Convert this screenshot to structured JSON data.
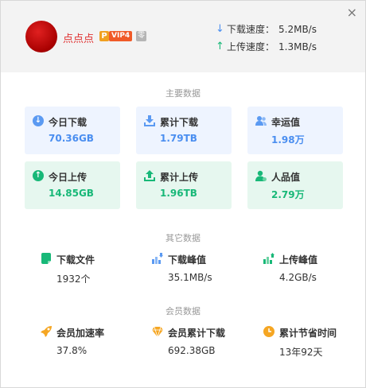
{
  "header": {
    "username": "点点点",
    "badge_p": "P",
    "badge_vip": "VIP4",
    "badge_level": "零",
    "close_icon": "×",
    "download_speed_label": "下载速度：",
    "download_speed_value": "5.2MB/s",
    "upload_speed_label": "上传速度：",
    "upload_speed_value": "1.3MB/s"
  },
  "main_section": {
    "title": "主要数据",
    "cards": [
      {
        "label": "今日下载",
        "value": "70.36GB",
        "icon": "down-circle-icon"
      },
      {
        "label": "累计下载",
        "value": "1.79TB",
        "icon": "download-tray-icon"
      },
      {
        "label": "幸运值",
        "value": "1.98万",
        "icon": "users-icon"
      },
      {
        "label": "今日上传",
        "value": "14.85GB",
        "icon": "up-circle-icon"
      },
      {
        "label": "累计上传",
        "value": "1.96TB",
        "icon": "upload-tray-icon"
      },
      {
        "label": "人品值",
        "value": "2.79万",
        "icon": "user-icon"
      }
    ]
  },
  "other_section": {
    "title": "其它数据",
    "stats": [
      {
        "label": "下载文件",
        "value": "1932个",
        "icon": "file-icon"
      },
      {
        "label": "下载峰值",
        "value": "35.1MB/s",
        "icon": "download-peak-icon"
      },
      {
        "label": "上传峰值",
        "value": "4.2GB/s",
        "icon": "upload-peak-icon"
      }
    ]
  },
  "member_section": {
    "title": "会员数据",
    "stats": [
      {
        "label": "会员加速率",
        "value": "37.8%",
        "icon": "rocket-icon"
      },
      {
        "label": "会员累计下载",
        "value": "692.38GB",
        "icon": "diamond-icon"
      },
      {
        "label": "累计节省时间",
        "value": "13年92天",
        "icon": "clock-icon"
      }
    ]
  },
  "colors": {
    "blue_accent": "#4a8ef0",
    "green_accent": "#18b878",
    "orange_accent": "#f5a623",
    "username_red": "#e03030"
  }
}
